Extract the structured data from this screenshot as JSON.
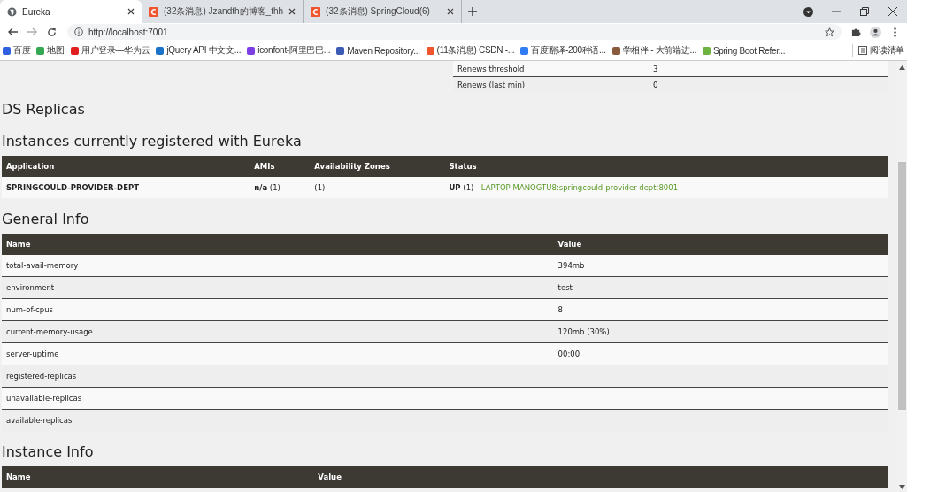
{
  "browser": {
    "tabs": [
      {
        "title": "Eureka",
        "selected": true,
        "kind": "globe"
      },
      {
        "title": "(32条消息) Jzandth的博客_thh",
        "selected": false,
        "kind": "csdn"
      },
      {
        "title": "(32条消息) SpringCloud(6) —",
        "selected": false,
        "kind": "csdn"
      }
    ],
    "address": "http://localhost:7001",
    "bookmarks": [
      {
        "label": "百度",
        "color": "#3060e0"
      },
      {
        "label": "地图",
        "color": "#34a853"
      },
      {
        "label": "用户登录—华为云",
        "color": "#e02020"
      },
      {
        "label": "jQuery API 中文文...",
        "color": "#1a73c8"
      },
      {
        "label": "iconfont-阿里巴巴...",
        "color": "#7b3fe4"
      },
      {
        "label": "Maven Repository...",
        "color": "#3b5bb5"
      },
      {
        "label": "(11条消息) CSDN -...",
        "color": "#f0562e"
      },
      {
        "label": "百度翻译-200种语...",
        "color": "#2f7cf6"
      },
      {
        "label": "学相伴 - 大前端进...",
        "color": "#8a5a3c"
      },
      {
        "label": "Spring Boot Refer...",
        "color": "#6db33f"
      }
    ],
    "reading_list": "阅读清单"
  },
  "page": {
    "lease_rows": [
      {
        "name": "Renews threshold",
        "value": "3"
      },
      {
        "name": "Renews (last min)",
        "value": "0"
      }
    ],
    "ds_replicas": "DS Replicas",
    "instances": {
      "heading": "Instances currently registered with Eureka",
      "columns": [
        "Application",
        "AMIs",
        "Availability Zones",
        "Status"
      ],
      "rows": [
        {
          "application": "SPRINGCOULD-PROVIDER-DEPT",
          "amis": "**n/a** (1)",
          "zones": "(1)",
          "status": "**UP** (1) - ",
          "link": "LAPTOP-MANOGTU8:springcould-provider-dept:8001"
        }
      ]
    },
    "general_info": {
      "heading": "General Info",
      "columns": [
        "Name",
        "Value"
      ],
      "rows": [
        {
          "name": "total-avail-memory",
          "value": "394mb"
        },
        {
          "name": "environment",
          "value": "test"
        },
        {
          "name": "num-of-cpus",
          "value": "8"
        },
        {
          "name": "current-memory-usage",
          "value": "120mb (30%)"
        },
        {
          "name": "server-uptime",
          "value": "00:00"
        },
        {
          "name": "registered-replicas",
          "value": ""
        },
        {
          "name": "unavailable-replicas",
          "value": ""
        },
        {
          "name": "available-replicas",
          "value": ""
        }
      ]
    },
    "instance_info": {
      "heading": "Instance Info",
      "columns": [
        "Name",
        "Value"
      ]
    }
  }
}
